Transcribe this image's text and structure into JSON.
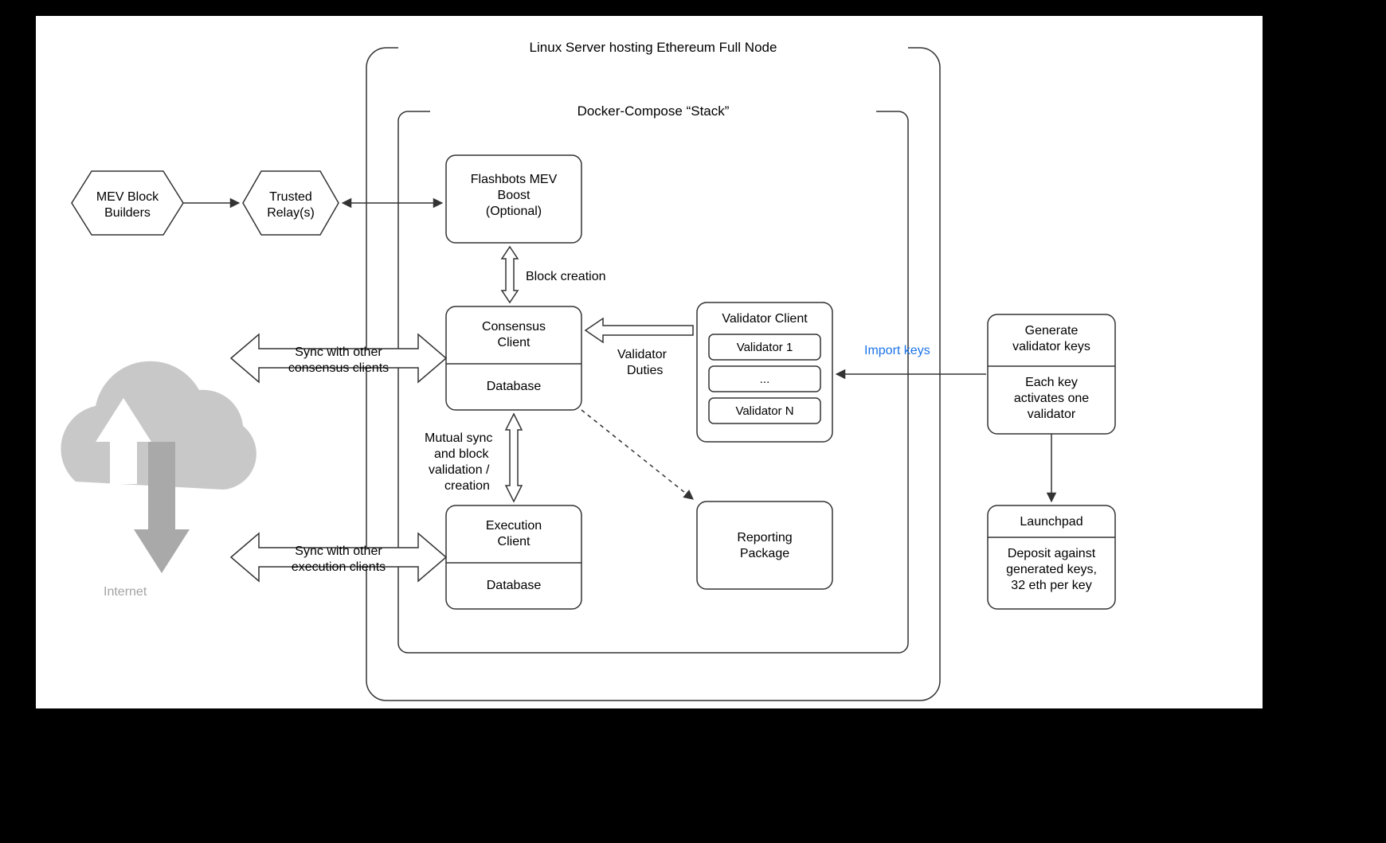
{
  "outer_title": "Linux Server hosting Ethereum Full Node",
  "inner_title": "Docker-Compose “Stack”",
  "hex1": {
    "l1": "MEV Block",
    "l2": "Builders"
  },
  "hex2": {
    "l1": "Trusted",
    "l2": "Relay(s)"
  },
  "mev": {
    "l1": "Flashbots MEV",
    "l2": "Boost",
    "l3": "(Optional)"
  },
  "block_creation": "Block creation",
  "consensus": {
    "title": "Consensus",
    "title2": "Client",
    "db": "Database"
  },
  "validator": {
    "title": "Validator Client",
    "v1": "Validator 1",
    "dots": "...",
    "vn": "Validator N"
  },
  "validator_duties": {
    "l1": "Validator",
    "l2": "Duties"
  },
  "import_keys": "Import keys",
  "gen_keys": {
    "title": "Generate",
    "title2": "validator keys",
    "s1": "Each key",
    "s2": "activates one",
    "s3": "validator"
  },
  "launchpad": {
    "title": "Launchpad",
    "s1": "Deposit against",
    "s2": "generated keys,",
    "s3": "32 eth per key"
  },
  "sync_consensus": {
    "l1": "Sync with other",
    "l2": "consensus clients"
  },
  "sync_execution": {
    "l1": "Sync with other",
    "l2": "execution clients"
  },
  "mutual_sync": {
    "l1": "Mutual sync",
    "l2": "and block",
    "l3": "validation /",
    "l4": "creation"
  },
  "execution": {
    "title": "Execution",
    "title2": "Client",
    "db": "Database"
  },
  "reporting": {
    "l1": "Reporting",
    "l2": "Package"
  },
  "internet": "Internet"
}
